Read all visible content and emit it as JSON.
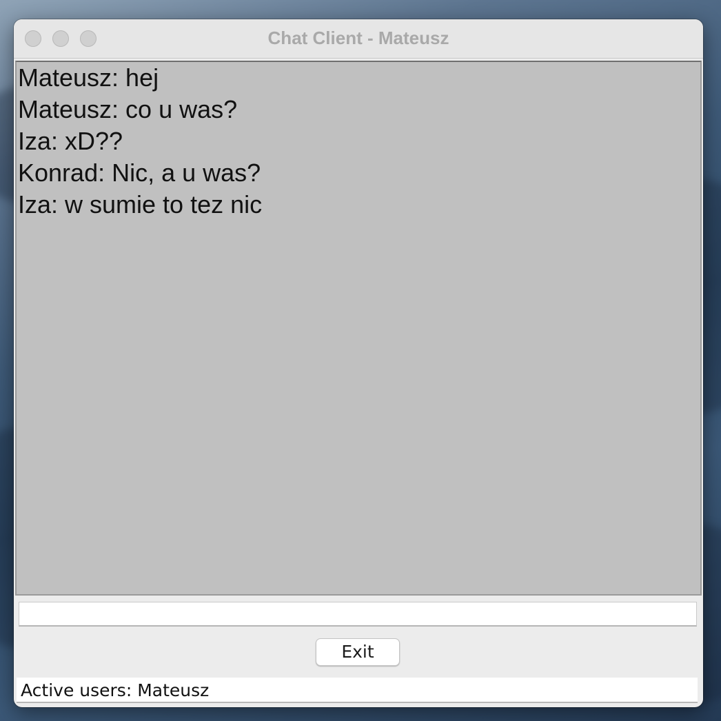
{
  "window": {
    "title": "Chat Client - Mateusz"
  },
  "chat": {
    "messages": [
      "Mateusz: hej",
      "Mateusz: co u was?",
      "Iza: xD??",
      "Konrad: Nic, a u was?",
      "Iza: w sumie to tez nic"
    ]
  },
  "composer": {
    "value": "",
    "placeholder": ""
  },
  "controls": {
    "exit_label": "Exit"
  },
  "status": {
    "active_users": "Active users: Mateusz"
  },
  "icons": {
    "close": "close-traffic-light-icon",
    "minimize": "minimize-traffic-light-icon",
    "maximize": "maximize-traffic-light-icon"
  },
  "colors": {
    "chat_background": "#c0c0c0",
    "window_background": "#ececec",
    "title_text": "#a9a9a9"
  }
}
